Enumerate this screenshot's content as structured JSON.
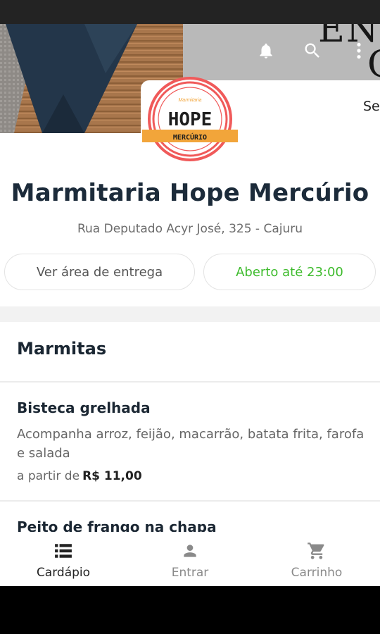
{
  "header": {
    "cover_text_line1": "EN",
    "cover_text_line2": "C",
    "info_peek": "Se",
    "icons": [
      "bell-icon",
      "search-icon",
      "more-vert-icon"
    ]
  },
  "logo": {
    "small_text": "Marmitaria",
    "brand": "HOPE",
    "subtitle": "MERCÚRIO",
    "colors": {
      "ring": "#f05a5a",
      "ribbon": "#f2a53a",
      "text": "#1e1e1e"
    }
  },
  "store": {
    "name": "Marmitaria Hope Mercúrio",
    "address": "Rua Deputado Acyr José, 325 - Cajuru",
    "area_button": "Ver área de entrega",
    "status": "Aberto até 23:00",
    "status_color": "#3dbb2c"
  },
  "menu": {
    "category": "Marmitas",
    "items": [
      {
        "name": "Bisteca grelhada",
        "description": "Acompanha arroz, feijão, macarrão, batata frita, farofa e salada",
        "price_prefix": "a partir de",
        "price": "R$ 11,00"
      },
      {
        "name": "Peito de frango na chapa"
      }
    ]
  },
  "bottom_nav": {
    "items": [
      {
        "label": "Cardápio",
        "icon": "list-icon",
        "active": true
      },
      {
        "label": "Entrar",
        "icon": "person-icon",
        "active": false
      },
      {
        "label": "Carrinho",
        "icon": "cart-icon",
        "active": false
      }
    ]
  }
}
